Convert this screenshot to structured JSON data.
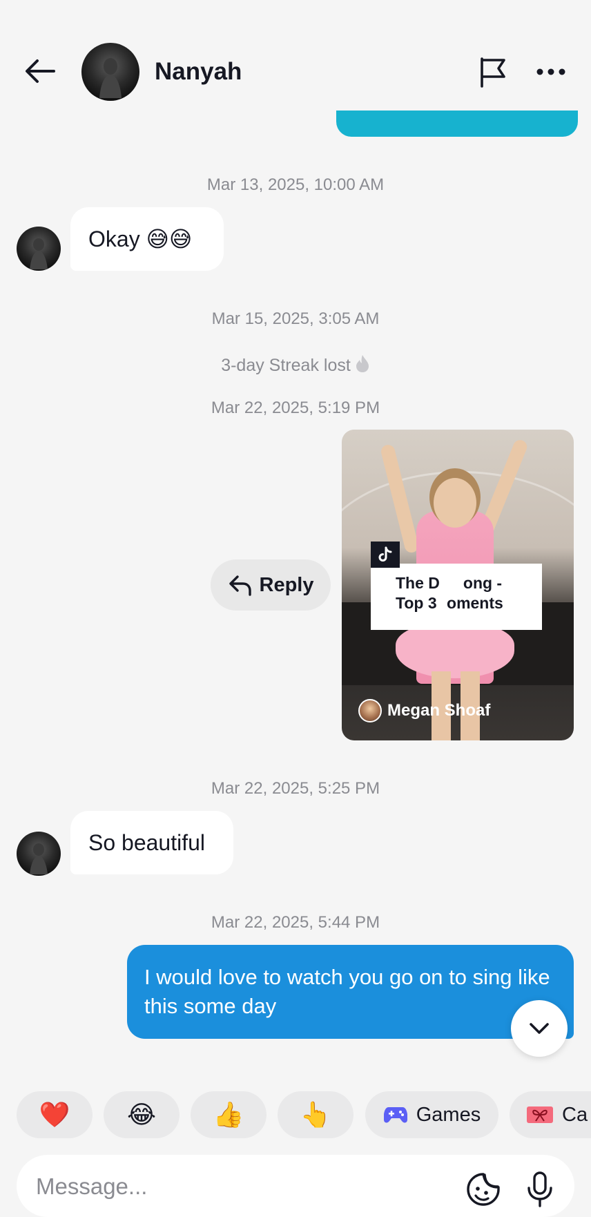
{
  "header": {
    "contact_name": "Nanyah",
    "back_icon": "arrow-left-icon",
    "flag_icon": "flag-icon",
    "more_icon": "more-horizontal-icon"
  },
  "colors": {
    "outgoing_bubble": "#1b8fdc",
    "outgoing_bubble_partial": "#17b2cf",
    "incoming_bubble": "#ffffff",
    "background": "#f5f5f5"
  },
  "messages": {
    "ts1": "Mar 13, 2025, 10:00 AM",
    "msg1": "Okay 😅😅",
    "ts2": "Mar 15, 2025, 3:05 AM",
    "streak": "3-day Streak lost",
    "ts3": "Mar 22, 2025, 5:19 PM",
    "reply_label": "Reply",
    "video": {
      "title_line1": "The D",
      "title_line1_end": "ong -",
      "title_line2_start": "Top 3 ",
      "title_line2_end": "oments",
      "creator": "Megan Shoaf"
    },
    "ts4": "Mar 22, 2025, 5:25 PM",
    "msg2": "So beautiful",
    "ts5": "Mar 22, 2025, 5:44 PM",
    "msg3": "I would love to watch you go on to sing like this some day"
  },
  "quick_replies": {
    "emojis": [
      "❤️",
      "😂",
      "👍",
      "👆"
    ],
    "games_label": "Games",
    "camera_label_partial": "Ca"
  },
  "composer": {
    "placeholder": "Message..."
  }
}
